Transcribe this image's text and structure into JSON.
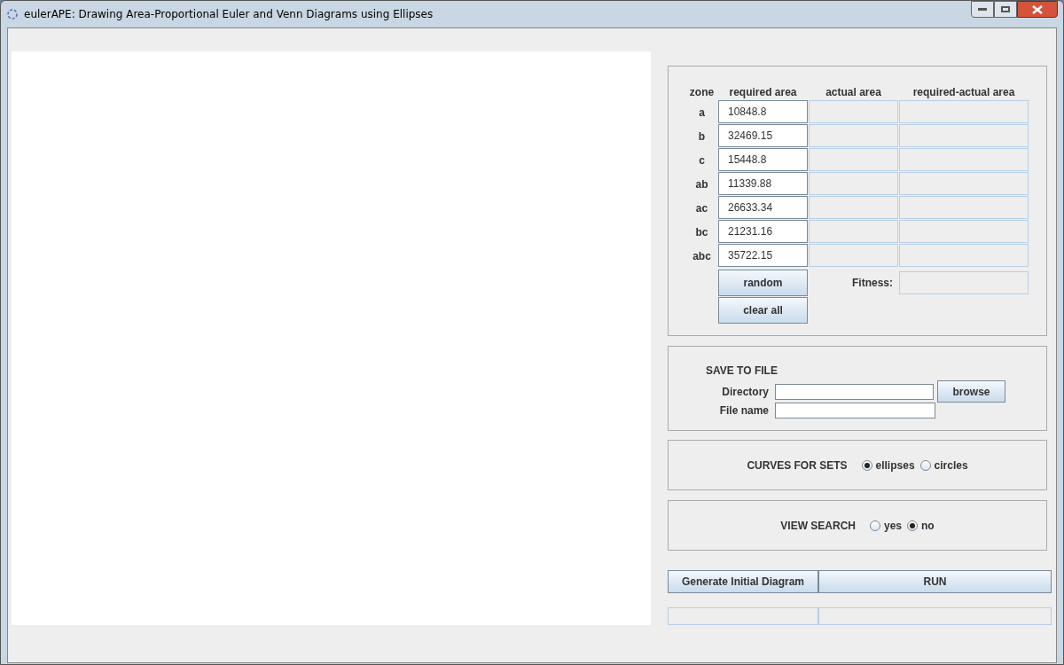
{
  "window": {
    "title": "eulerAPE: Drawing Area-Proportional Euler and Venn Diagrams using Ellipses"
  },
  "zones_table": {
    "columns": [
      "zone",
      "required area",
      "actual area",
      "required-actual area"
    ],
    "rows": [
      {
        "zone": "a",
        "required": "10848.8"
      },
      {
        "zone": "b",
        "required": "32469.15"
      },
      {
        "zone": "c",
        "required": "15448.8"
      },
      {
        "zone": "ab",
        "required": "11339.88"
      },
      {
        "zone": "ac",
        "required": "26633.34"
      },
      {
        "zone": "bc",
        "required": "21231.16"
      },
      {
        "zone": "abc",
        "required": "35722.15"
      }
    ],
    "buttons": [
      "random",
      "clear all"
    ],
    "fitness_label": "Fitness:"
  },
  "save_to_file": {
    "title": "SAVE TO FILE",
    "directory_label": "Directory",
    "file_name_label": "File name",
    "browse_button": "browse"
  },
  "curves": {
    "label": "CURVES FOR SETS",
    "options": [
      {
        "label": "ellipses",
        "selected": true
      },
      {
        "label": "circles",
        "selected": false
      }
    ]
  },
  "view_search": {
    "label": "VIEW SEARCH",
    "options": [
      {
        "label": "yes",
        "selected": false
      },
      {
        "label": "no",
        "selected": true
      }
    ]
  },
  "actions": [
    "Generate Initial Diagram",
    "RUN"
  ]
}
